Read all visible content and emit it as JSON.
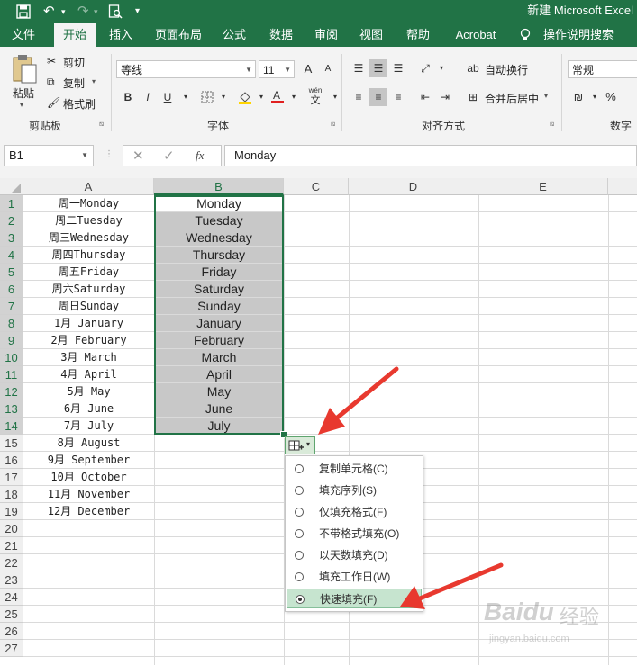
{
  "app": {
    "title": "新建 Microsoft Excel",
    "menu_tabs": [
      "文件",
      "开始",
      "插入",
      "页面布局",
      "公式",
      "数据",
      "审阅",
      "视图",
      "帮助",
      "Acrobat",
      "操作说明搜索"
    ],
    "active_tab_index": 1,
    "tab_color": "#217346"
  },
  "ribbon": {
    "clipboard": {
      "paste": "粘贴",
      "cut": "剪切",
      "copy": "复制",
      "format_painter": "格式刷",
      "label": "剪贴板"
    },
    "font": {
      "name": "等线",
      "size": "11",
      "bold": "B",
      "italic": "I",
      "underline": "U",
      "label": "字体",
      "grow": "A",
      "shrink": "A",
      "wen": "wén",
      "wen_char": "文"
    },
    "alignment": {
      "wrap": "自动换行",
      "merge": "合并后居中",
      "label": "对齐方式"
    },
    "number": {
      "format": "常规",
      "percent": "%",
      "label": "数字"
    }
  },
  "formula_bar": {
    "name_box": "B1",
    "fx": "fx",
    "formula": "Monday"
  },
  "grid": {
    "columns": [
      "A",
      "B",
      "C",
      "D",
      "E"
    ],
    "rows": [
      "1",
      "2",
      "3",
      "4",
      "5",
      "6",
      "7",
      "8",
      "9",
      "10",
      "11",
      "12",
      "13",
      "14",
      "15",
      "16",
      "17",
      "18",
      "19",
      "20",
      "21",
      "22",
      "23",
      "24",
      "25",
      "26",
      "27"
    ],
    "col_a": [
      "周一Monday",
      "周二Tuesday",
      "周三Wednesday",
      "周四Thursday",
      "周五Friday",
      "周六Saturday",
      "周日Sunday",
      "1月 January",
      "2月 February",
      "3月 March",
      "4月 April",
      "5月 May",
      "6月 June",
      "7月 July",
      "8月 August",
      "9月 September",
      "10月 October",
      "11月 November",
      "12月 December"
    ],
    "col_b": [
      "Monday",
      "Tuesday",
      "Wednesday",
      "Thursday",
      "Friday",
      "Saturday",
      "Sunday",
      "January",
      "February",
      "March",
      "April",
      "May",
      "June",
      "July"
    ]
  },
  "autofill_menu": {
    "items": [
      "复制单元格(C)",
      "填充序列(S)",
      "仅填充格式(F)",
      "不带格式填充(O)",
      "以天数填充(D)",
      "填充工作日(W)",
      "快速填充(F)"
    ],
    "selected_index": 6
  },
  "watermark": {
    "brand": "Baidu",
    "sub": "经验",
    "url": "jingyan.baidu.com"
  },
  "colors": {
    "excel_green": "#217346",
    "selection_fill": "#c8c8c8",
    "arrow": "#e8392f"
  }
}
